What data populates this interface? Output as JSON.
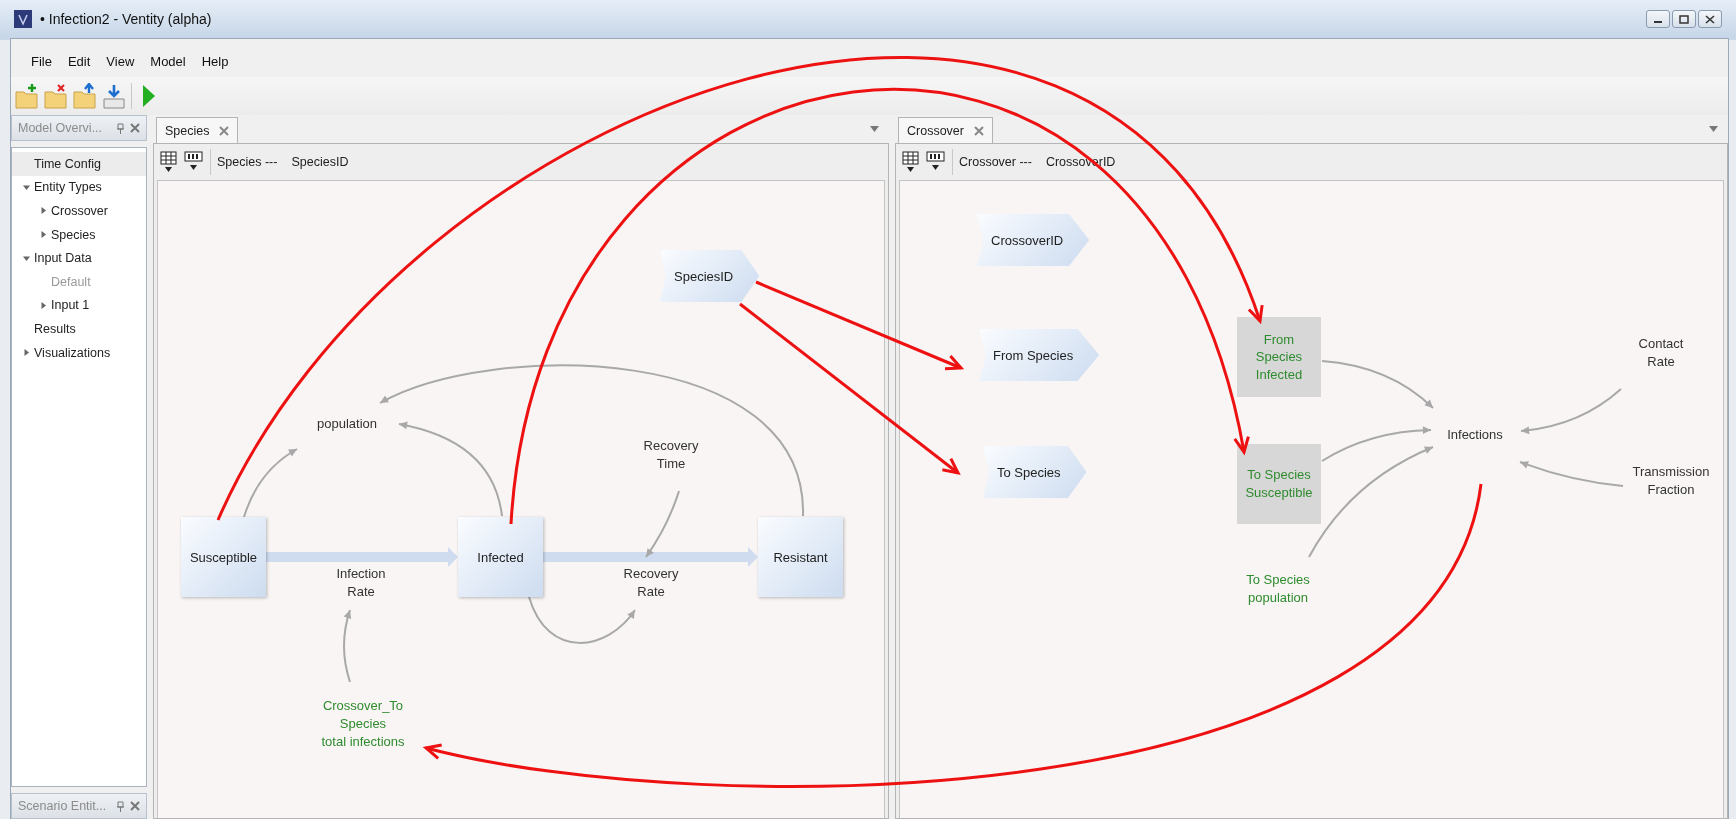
{
  "window": {
    "title": "• Infection2 - Ventity (alpha)"
  },
  "menu": [
    "File",
    "Edit",
    "View",
    "Model",
    "Help"
  ],
  "sidebar": {
    "title": "Model Overvi...",
    "items": [
      {
        "label": "Time Config",
        "selected": true,
        "disabled": false
      },
      {
        "label": "Entity Types",
        "selected": false,
        "disabled": false,
        "expanded": true,
        "children": [
          {
            "label": "Crossover",
            "selected": false,
            "disabled": false,
            "expanded": false
          },
          {
            "label": "Species",
            "selected": false,
            "disabled": false,
            "expanded": false
          }
        ]
      },
      {
        "label": "Input Data",
        "selected": false,
        "disabled": false,
        "expanded": true,
        "children": [
          {
            "label": "Default",
            "selected": false,
            "disabled": true
          },
          {
            "label": "Input 1",
            "selected": false,
            "disabled": false,
            "expanded": false
          }
        ]
      },
      {
        "label": "Results",
        "selected": false,
        "disabled": false
      },
      {
        "label": "Visualizations",
        "selected": false,
        "disabled": false,
        "expanded": false
      }
    ]
  },
  "bottom_panel": {
    "title": "Scenario Entit..."
  },
  "panels": [
    {
      "tab": "Species",
      "breadcrumb": [
        "Species ---",
        "SpeciesID"
      ],
      "nodes": [
        {
          "kind": "stock",
          "text": "Susceptible"
        },
        {
          "kind": "stock",
          "text": "Infected"
        },
        {
          "kind": "stock",
          "text": "Resistant"
        },
        {
          "kind": "aux",
          "text": "population",
          "color": "#333333"
        },
        {
          "kind": "aux",
          "text": "Infection\nRate",
          "color": "#333333"
        },
        {
          "kind": "aux",
          "text": "Recovery\nTime",
          "color": "#333333"
        },
        {
          "kind": "aux",
          "text": "Recovery\nRate",
          "color": "#333333"
        },
        {
          "kind": "input",
          "text": "SpeciesID"
        },
        {
          "kind": "aux",
          "text": "Crossover_To\nSpecies\ntotal infections",
          "color": "#2e8b2e"
        }
      ]
    },
    {
      "tab": "Crossover",
      "breadcrumb": [
        "Crossover ---",
        "CrossoverID"
      ],
      "nodes": [
        {
          "kind": "input",
          "text": "CrossoverID"
        },
        {
          "kind": "input",
          "text": "From Species"
        },
        {
          "kind": "input",
          "text": "To Species"
        },
        {
          "kind": "ghost",
          "text": "From\nSpecies\nInfected"
        },
        {
          "kind": "ghost",
          "text": "To Species\nSusceptible"
        },
        {
          "kind": "aux",
          "text": "To Species\npopulation",
          "color": "#2e8b2e"
        },
        {
          "kind": "aux",
          "text": "Infections",
          "color": "#333333"
        },
        {
          "kind": "aux",
          "text": "Contact\nRate",
          "color": "#333333"
        },
        {
          "kind": "aux",
          "text": "Transmission\nFraction",
          "color": "#333333"
        }
      ]
    }
  ]
}
